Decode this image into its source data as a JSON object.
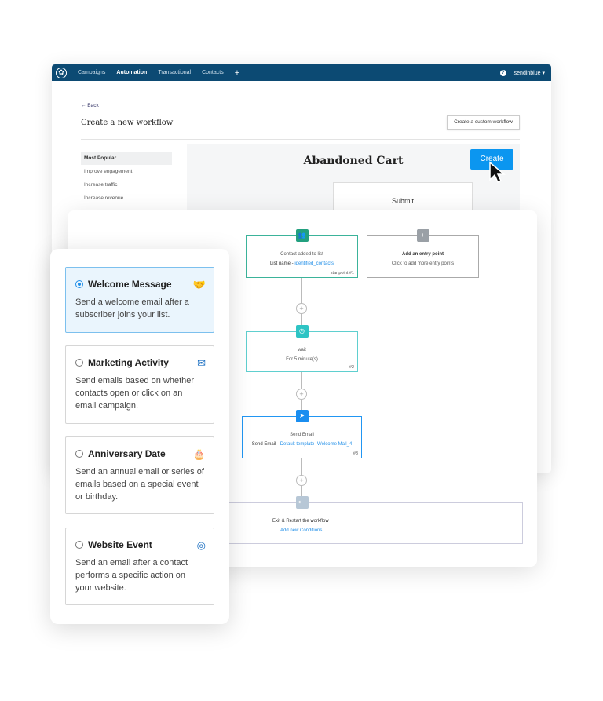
{
  "nav": {
    "items": [
      "Campaigns",
      "Automation",
      "Transactional",
      "Contacts"
    ],
    "active": "Automation",
    "account": "sendinblue"
  },
  "page": {
    "back": "← Back",
    "title": "Create a new workflow",
    "custom_button": "Create a custom workflow"
  },
  "sidebar": [
    "Most Popular",
    "Improve engagement",
    "Increase traffic",
    "Increase revenue"
  ],
  "preview": {
    "title": "Abandoned Cart",
    "create": "Create",
    "submit": "Submit"
  },
  "workflow": {
    "start": {
      "title": "Contact added to list",
      "label": "List name - ",
      "value": "identified_contacts",
      "num": "startpoint #1"
    },
    "entry": {
      "title": "Add an entry point",
      "sub": "Click to add more entry points"
    },
    "wait": {
      "title": "wait",
      "sub": "For 5 minute(s)",
      "num": "#2"
    },
    "send": {
      "title": "Send Email",
      "label": "Send Email - ",
      "value": "Default template -Welcome Mail_4",
      "num": "#3"
    },
    "exit": {
      "title": "Exit & Restart the workflow",
      "link": "Add new Conditions"
    }
  },
  "options": [
    {
      "title": "Welcome Message",
      "desc": "Send a welcome email after a subscriber joins your list.",
      "icon": "handshake-icon",
      "selected": true
    },
    {
      "title": "Marketing Activity",
      "desc": "Send emails based on whether contacts open or click on an email campaign.",
      "icon": "envelope-icon",
      "selected": false
    },
    {
      "title": "Anniversary Date",
      "desc": "Send an annual email or series of emails based on a special event or birthday.",
      "icon": "cake-icon",
      "selected": false
    },
    {
      "title": "Website Event",
      "desc": "Send an email after a contact performs a specific action on your website.",
      "icon": "target-click-icon",
      "selected": false
    }
  ],
  "colors": {
    "nav": "#0c4a73",
    "accent": "#0b96f0",
    "teal": "#3bb39a"
  }
}
